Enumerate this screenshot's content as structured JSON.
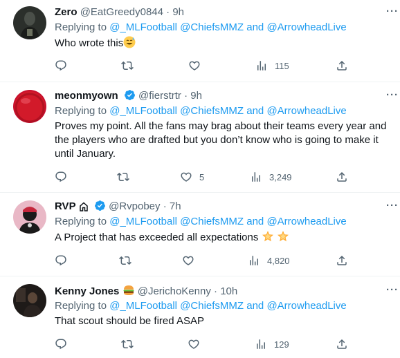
{
  "tweets": [
    {
      "name": "Zero",
      "handle": "@EatGreedy0844",
      "sep": "·",
      "time": "9h",
      "replying_label": "Replying to",
      "mentions": [
        "@_MLFootball",
        "@ChiefsMMZ",
        "@ArrowheadLive"
      ],
      "and": "and",
      "text": "Who wrote this",
      "reply_count": "",
      "retweet_count": "",
      "like_count": "",
      "views": "115"
    },
    {
      "name": "meonmyown",
      "handle": "@fierstrtr",
      "sep": "·",
      "time": "9h",
      "replying_label": "Replying to",
      "mentions": [
        "@_MLFootball",
        "@ChiefsMMZ",
        "@ArrowheadLive"
      ],
      "and": "and",
      "text": "Proves my point. All the fans may brag about their teams every year and the players who are drafted but you don’t know who is going to make it until January.",
      "reply_count": "",
      "retweet_count": "",
      "like_count": "5",
      "views": "3,249"
    },
    {
      "name": "RVP",
      "handle": "@Rvpobey",
      "sep": "·",
      "time": "7h",
      "replying_label": "Replying to",
      "mentions": [
        "@_MLFootball",
        "@ChiefsMMZ",
        "@ArrowheadLive"
      ],
      "and": "and",
      "text": "A Project that has exceeded all expectations",
      "reply_count": "",
      "retweet_count": "",
      "like_count": "",
      "views": "4,820"
    },
    {
      "name": "Kenny Jones",
      "handle": "@JerichoKenny",
      "sep": "·",
      "time": "10h",
      "replying_label": "Replying to",
      "mentions": [
        "@_MLFootball",
        "@ChiefsMMZ",
        "@ArrowheadLive"
      ],
      "and": "and",
      "text": "That scout should be fired ASAP",
      "reply_count": "",
      "retweet_count": "",
      "like_count": "",
      "views": "129"
    }
  ],
  "icons": {
    "reply": "reply-icon",
    "retweet": "retweet-icon",
    "like": "heart-icon",
    "views": "views-chart-icon",
    "share": "share-icon",
    "more": "more-icon",
    "verified": "verified-badge-icon"
  },
  "colors": {
    "accent": "#1d9bf0",
    "secondary_text": "#536471",
    "primary_text": "#0f1419",
    "divider": "#eff3f4"
  }
}
